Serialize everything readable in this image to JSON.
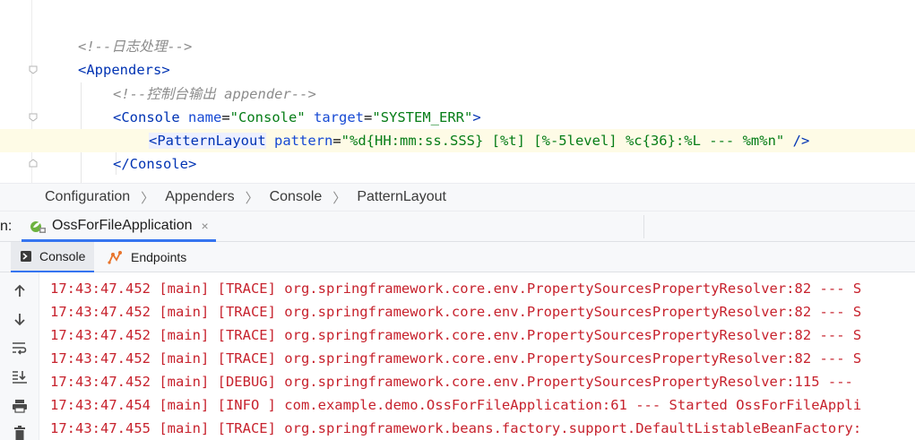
{
  "editor": {
    "lines": [
      {
        "id": "comment-log",
        "parts": [
          {
            "t": "cm",
            "text": "<!--日志处理-->"
          }
        ]
      },
      {
        "id": "appenders-open",
        "parts": [
          {
            "t": "tag",
            "text": "<Appenders"
          },
          {
            "t": "tag",
            "text": ">"
          }
        ]
      },
      {
        "id": "comment-console",
        "parts": [
          {
            "t": "cm",
            "text": "<!--控制台输出 appender-->"
          }
        ]
      },
      {
        "id": "console-open",
        "parts": [
          {
            "t": "tag",
            "text": "<Console"
          },
          {
            "t": "pun",
            "text": " "
          },
          {
            "t": "attr",
            "text": "name"
          },
          {
            "t": "pun",
            "text": "="
          },
          {
            "t": "val",
            "text": "\"Console\""
          },
          {
            "t": "pun",
            "text": " "
          },
          {
            "t": "attr",
            "text": "target"
          },
          {
            "t": "pun",
            "text": "="
          },
          {
            "t": "val",
            "text": "\"SYSTEM_ERR\""
          },
          {
            "t": "tag",
            "text": ">"
          }
        ]
      },
      {
        "id": "pattern-layout",
        "parts": [
          {
            "t": "taghl",
            "text": "<PatternLayout"
          },
          {
            "t": "pun",
            "text": " "
          },
          {
            "t": "attr",
            "text": "pattern"
          },
          {
            "t": "pun",
            "text": "="
          },
          {
            "t": "val",
            "text": "\"%d{HH:mm:ss.SSS} [%t] [%-5level] %c{36}:%L --- %m%n\""
          },
          {
            "t": "pun",
            "text": " "
          },
          {
            "t": "tag",
            "text": "/>"
          }
        ]
      },
      {
        "id": "console-close",
        "parts": [
          {
            "t": "tag",
            "text": "</Console"
          },
          {
            "t": "tag",
            "text": ">"
          }
        ]
      }
    ]
  },
  "breadcrumb": [
    "Configuration",
    "Appenders",
    "Console",
    "PatternLayout"
  ],
  "run_window": {
    "label": "n:",
    "tab_label": "OssForFileApplication",
    "close_glyph": "×",
    "subtabs": {
      "console": "Console",
      "endpoints": "Endpoints"
    }
  },
  "console": {
    "lines": [
      "17:43:47.452 [main] [TRACE] org.springframework.core.env.PropertySourcesPropertyResolver:82 --- S",
      "17:43:47.452 [main] [TRACE] org.springframework.core.env.PropertySourcesPropertyResolver:82 --- S",
      "17:43:47.452 [main] [TRACE] org.springframework.core.env.PropertySourcesPropertyResolver:82 --- S",
      "17:43:47.452 [main] [TRACE] org.springframework.core.env.PropertySourcesPropertyResolver:82 --- S",
      "17:43:47.452 [main] [DEBUG] org.springframework.core.env.PropertySourcesPropertyResolver:115 --- ",
      "17:43:47.454 [main] [INFO ] com.example.demo.OssForFileApplication:61 --- Started OssForFileAppli",
      "17:43:47.455 [main] [TRACE] org.springframework.beans.factory.support.DefaultListableBeanFactory:"
    ]
  },
  "icons": {
    "fold": "fold-marker-icon",
    "spring": "spring-boot-icon",
    "console": "console-icon",
    "endpoints": "endpoints-icon",
    "up": "arrow-up-icon",
    "down": "arrow-down-icon",
    "wrap": "soft-wrap-icon",
    "scroll": "scroll-to-end-icon",
    "print": "print-icon",
    "trash": "trash-icon"
  },
  "colors": {
    "accent": "#3574f0",
    "log_text": "#c7222d",
    "xml_tag": "#0033b3",
    "xml_attr": "#174ad4",
    "xml_value": "#067d17",
    "comment": "#8c8c8c"
  }
}
